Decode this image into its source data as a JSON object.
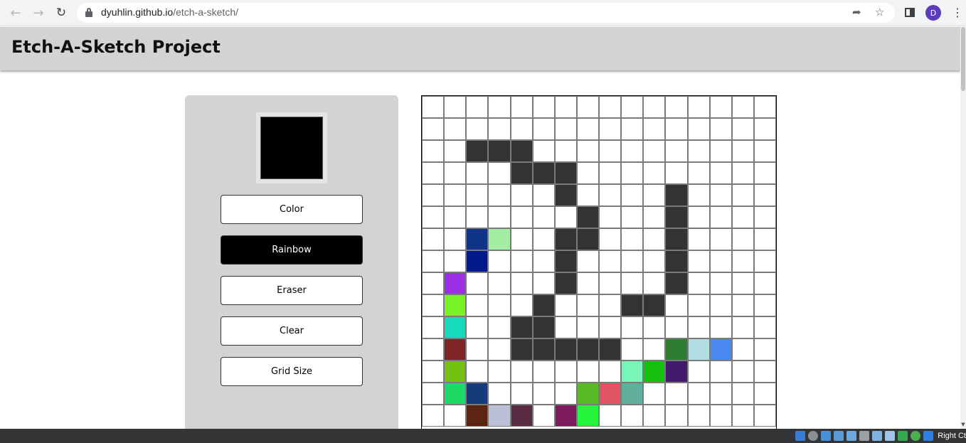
{
  "browser": {
    "url_host": "dyuhlin.github.io",
    "url_path": "/etch-a-sketch/",
    "profile_initial": "D"
  },
  "page": {
    "title": "Etch-A-Sketch Project"
  },
  "controls": {
    "current_color": "#000000",
    "buttons": [
      {
        "label": "Color",
        "active": false
      },
      {
        "label": "Rainbow",
        "active": true
      },
      {
        "label": "Eraser",
        "active": false
      },
      {
        "label": "Clear",
        "active": false
      },
      {
        "label": "Grid Size",
        "active": false
      }
    ]
  },
  "grid": {
    "columns": 16,
    "visible_rows": 15,
    "background": "#ffffff",
    "painted_cells": [
      {
        "r": 2,
        "c": 2,
        "color": "#333333"
      },
      {
        "r": 2,
        "c": 3,
        "color": "#333333"
      },
      {
        "r": 2,
        "c": 4,
        "color": "#333333"
      },
      {
        "r": 3,
        "c": 4,
        "color": "#333333"
      },
      {
        "r": 3,
        "c": 5,
        "color": "#333333"
      },
      {
        "r": 3,
        "c": 6,
        "color": "#333333"
      },
      {
        "r": 4,
        "c": 6,
        "color": "#333333"
      },
      {
        "r": 4,
        "c": 11,
        "color": "#333333"
      },
      {
        "r": 5,
        "c": 7,
        "color": "#333333"
      },
      {
        "r": 5,
        "c": 11,
        "color": "#333333"
      },
      {
        "r": 6,
        "c": 2,
        "color": "#0f3487"
      },
      {
        "r": 6,
        "c": 3,
        "color": "#a3eea3"
      },
      {
        "r": 6,
        "c": 6,
        "color": "#333333"
      },
      {
        "r": 6,
        "c": 7,
        "color": "#333333"
      },
      {
        "r": 6,
        "c": 11,
        "color": "#333333"
      },
      {
        "r": 7,
        "c": 2,
        "color": "#001a8a"
      },
      {
        "r": 7,
        "c": 6,
        "color": "#333333"
      },
      {
        "r": 7,
        "c": 11,
        "color": "#333333"
      },
      {
        "r": 8,
        "c": 1,
        "color": "#9b2fe6"
      },
      {
        "r": 8,
        "c": 6,
        "color": "#333333"
      },
      {
        "r": 8,
        "c": 11,
        "color": "#333333"
      },
      {
        "r": 9,
        "c": 1,
        "color": "#78f224"
      },
      {
        "r": 9,
        "c": 5,
        "color": "#333333"
      },
      {
        "r": 9,
        "c": 9,
        "color": "#333333"
      },
      {
        "r": 9,
        "c": 10,
        "color": "#333333"
      },
      {
        "r": 10,
        "c": 1,
        "color": "#14dbbd"
      },
      {
        "r": 10,
        "c": 4,
        "color": "#333333"
      },
      {
        "r": 10,
        "c": 5,
        "color": "#333333"
      },
      {
        "r": 11,
        "c": 1,
        "color": "#7d2625"
      },
      {
        "r": 11,
        "c": 4,
        "color": "#333333"
      },
      {
        "r": 11,
        "c": 5,
        "color": "#333333"
      },
      {
        "r": 11,
        "c": 6,
        "color": "#333333"
      },
      {
        "r": 11,
        "c": 7,
        "color": "#333333"
      },
      {
        "r": 11,
        "c": 8,
        "color": "#333333"
      },
      {
        "r": 11,
        "c": 11,
        "color": "#2f7d33"
      },
      {
        "r": 11,
        "c": 12,
        "color": "#b2dde3"
      },
      {
        "r": 11,
        "c": 13,
        "color": "#4a8af2"
      },
      {
        "r": 12,
        "c": 1,
        "color": "#72c20f"
      },
      {
        "r": 12,
        "c": 9,
        "color": "#7af5b8"
      },
      {
        "r": 12,
        "c": 10,
        "color": "#16c20e"
      },
      {
        "r": 12,
        "c": 11,
        "color": "#421b6b"
      },
      {
        "r": 13,
        "c": 1,
        "color": "#1fd865"
      },
      {
        "r": 13,
        "c": 2,
        "color": "#163a7a"
      },
      {
        "r": 13,
        "c": 7,
        "color": "#5bba28"
      },
      {
        "r": 13,
        "c": 8,
        "color": "#e05462"
      },
      {
        "r": 13,
        "c": 9,
        "color": "#62ae9a"
      },
      {
        "r": 14,
        "c": 2,
        "color": "#5c2512"
      },
      {
        "r": 14,
        "c": 3,
        "color": "#bcc0d6"
      },
      {
        "r": 14,
        "c": 4,
        "color": "#5a2b42"
      },
      {
        "r": 14,
        "c": 6,
        "color": "#7e1b5e"
      },
      {
        "r": 14,
        "c": 7,
        "color": "#25f53c"
      }
    ]
  },
  "taskbar": {
    "right_text": "Right Ct"
  }
}
